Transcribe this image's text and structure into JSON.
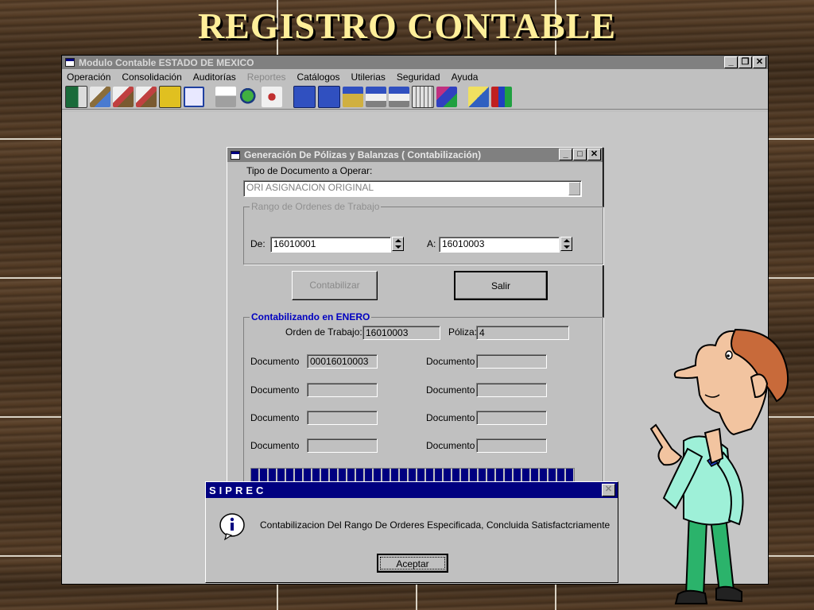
{
  "slide": {
    "title": "REGISTRO CONTABLE"
  },
  "main_window": {
    "title": "Modulo Contable ESTADO DE MEXICO",
    "controls": {
      "minimize": "_",
      "restore": "❐",
      "close": "✕"
    },
    "menu": [
      {
        "label": "Operación",
        "enabled": true
      },
      {
        "label": "Consolidación",
        "enabled": true
      },
      {
        "label": "Auditorías",
        "enabled": true
      },
      {
        "label": "Reportes",
        "enabled": false
      },
      {
        "label": "Catálogos",
        "enabled": true
      },
      {
        "label": "Utilerias",
        "enabled": true
      },
      {
        "label": "Seguridad",
        "enabled": true
      },
      {
        "label": "Ayuda",
        "enabled": true
      }
    ]
  },
  "dialog": {
    "title": "Generación De Pólizas y  Balanzas ( Contabilización)",
    "controls": {
      "minimize": "_",
      "maximize": "□",
      "close": "✕"
    },
    "doc_type_label": "Tipo de Documento a Operar:",
    "doc_type_value": "ORI ASIGNACION ORIGINAL",
    "range_group": "Rango de Ordenes de Trabajo",
    "from_label": "De:",
    "from_value": "16010001",
    "to_label": "A:",
    "to_value": "16010003",
    "btn_contabilizar": "Contabilizar",
    "btn_salir": "Salir",
    "status_group": "Contabilizando en  ENERO",
    "orden_label": "Orden de Trabajo:",
    "orden_value": "16010003",
    "poliza_label": "Póliza:",
    "poliza_value": "4",
    "doc_label": "Documento",
    "documents": [
      "00016010003",
      "",
      "",
      "",
      "",
      "",
      "",
      ""
    ],
    "progress": 1.0
  },
  "message_box": {
    "title": "SIPREC",
    "close": "✕",
    "text": "Contabilizacion Del Rango De Orderes Especificada, Concluida Satisfactcriamente",
    "ok": "Aceptar"
  },
  "colors": {
    "title_text": "#ffef9a",
    "status_blue": "#0000c0",
    "titlebar_inactive": "#808080",
    "titlebar_active": "#000080"
  }
}
